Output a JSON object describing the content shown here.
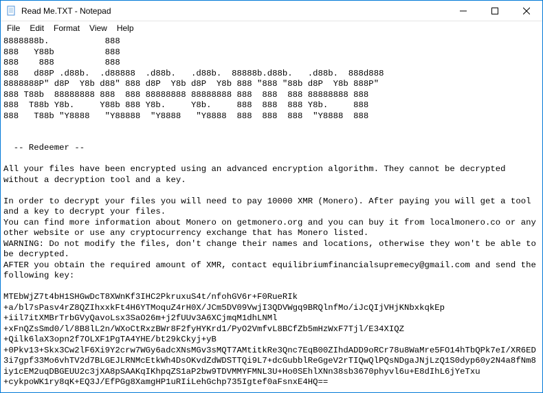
{
  "window": {
    "title": "Read Me.TXT - Notepad"
  },
  "menu": {
    "file": "File",
    "edit": "Edit",
    "format": "Format",
    "view": "View",
    "help": "Help"
  },
  "content": {
    "ascii_art": "8888888b.           888\n888   Y88b          888\n888    888          888\n888   d88P .d88b.  .d88888  .d88b.   .d88b.  88888b.d88b.   .d88b.  888d888\n8888888P\" d8P  Y8b d88\" 888 d8P  Y8b d8P  Y8b 888 \"888 \"88b d8P  Y8b 888P\"\n888 T88b  88888888 888  888 88888888 88888888 888  888  888 88888888 888\n888  T88b Y8b.     Y88b 888 Y8b.     Y8b.     888  888  888 Y8b.     888\n888   T88b \"Y8888   \"Y88888  \"Y8888   \"Y8888  888  888  888  \"Y8888  888",
    "section_header": "  -- Redeemer --",
    "body_p1": "All your files have been encrypted using an advanced encryption algorithm. They cannot be decrypted without a decryption tool and a key.",
    "body_p2": "In order to decrypt your files you will need to pay 10000 XMR (Monero). After paying you will get a tool and a key to decrypt your files.",
    "body_p3": "You can find more information about Monero on getmonero.org and you can buy it from localmonero.co or any other website or use any cryptocurrency exchange that has Monero listed.",
    "body_p4": "WARNING: Do not modify the files, don't change their names and locations, otherwise they won't be able to be decrypted.",
    "body_p5": "AFTER you obtain the required amount of XMR, contact equilibriumfinancialsupremecy@gmail.com and send the following key:",
    "key": "MTEbWjZ7t4bH1SHGwDcT8XWnKf3IHC2PkruxuS4t/nfohGV6r+F0RueRIk\n+a/bl7sPasv4rZ8QZIhxxkFt4H6YTMoquZ4rH0X/JCm5DV09VwjI3QDVWgq9BRQlnfMo/iJcQIjVHjKNbxkqkEp\n+iil7itXMBrTrbGVyQavoLsx3SaO26m+j2fUUv3A6XCjmqM1dhLNMl\n+xFnQZsSmd0/l/8B8lL2n/WXoCtRxzBWr8F2fyHYKrd1/PyO2VmfvL8BCfZb5mHzWxF7Tjl/E34XIQZ\n+Qilk6laX3opn2f7OLXF1PgTA4YHE/bt29kCkyj+yB\n+0Pkv13+Skx3Cw2lF6Xi9Y2crw7WGy6adcXNsMGv3sMQT7AMtitkRe3Qnc7EqB00ZIhdADD9oRCr78u8WaMre5FO14hTbQPk7eI/XR6ED3i7gpf33Mo6vhTV2d7BLGEJLRNMcEtkWh4DsOKvdZdWDSTTQi9L7+dcGubblReGgeV2rTIQwQlPQsNDgaJNjLzQ1S0dyp60y2N4a8fNm8iy1cEM2uqDBGEUU2c3jXA8pSAAKqIKhpqZS1aP2bw9TDVMMYFMNL3U+Ho0SEhlXNn38sb3670phyvl6u+E8dIhL6jYeTxu\n+cykpoWK1ry8qK+EQ3J/EfPGg8XamgHP1uRIiLehGchp735Igtef0aFsnxE4HQ=="
  }
}
